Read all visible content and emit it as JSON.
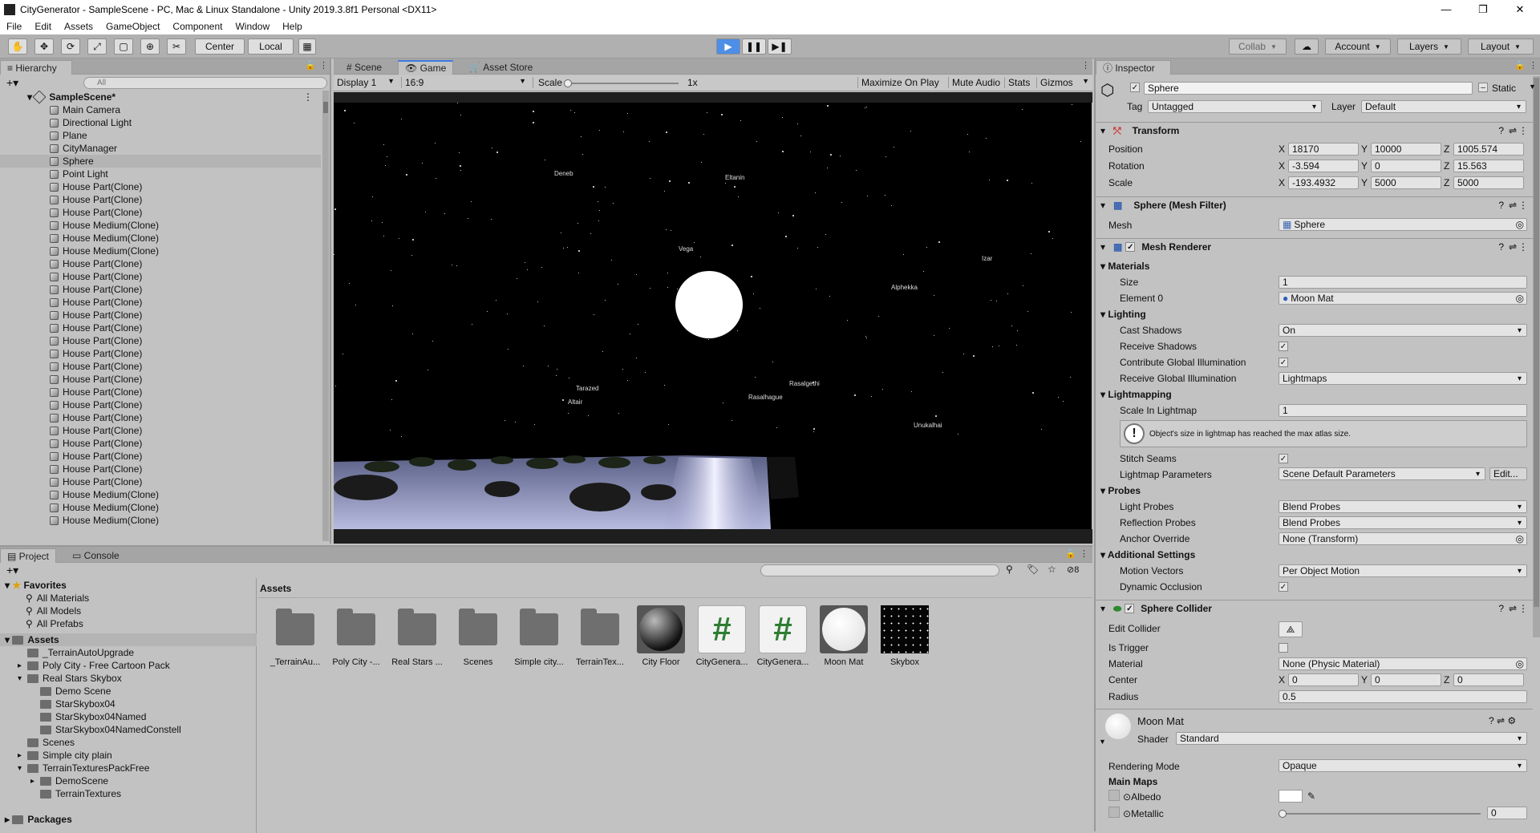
{
  "window": {
    "title": "CityGenerator - SampleScene - PC, Mac & Linux Standalone - Unity 2019.3.8f1 Personal <DX11>"
  },
  "menu": [
    "File",
    "Edit",
    "Assets",
    "GameObject",
    "Component",
    "Window",
    "Help"
  ],
  "toolbar": {
    "center_label": "Center",
    "local_label": "Local",
    "collab_label": "Collab",
    "account_label": "Account",
    "layers_label": "Layers",
    "layout_label": "Layout"
  },
  "hierarchy": {
    "tab": "Hierarchy",
    "search_placeholder": "All",
    "scene": "SampleScene*",
    "items": [
      "Main Camera",
      "Directional Light",
      "Plane",
      "CityManager",
      "Sphere",
      "Point Light",
      "House Part(Clone)",
      "House Part(Clone)",
      "House Part(Clone)",
      "House Medium(Clone)",
      "House Medium(Clone)",
      "House Medium(Clone)",
      "House Part(Clone)",
      "House Part(Clone)",
      "House Part(Clone)",
      "House Part(Clone)",
      "House Part(Clone)",
      "House Part(Clone)",
      "House Part(Clone)",
      "House Part(Clone)",
      "House Part(Clone)",
      "House Part(Clone)",
      "House Part(Clone)",
      "House Part(Clone)",
      "House Part(Clone)",
      "House Part(Clone)",
      "House Part(Clone)",
      "House Part(Clone)",
      "House Part(Clone)",
      "House Part(Clone)",
      "House Medium(Clone)",
      "House Medium(Clone)",
      "House Medium(Clone)"
    ],
    "selected": "Sphere"
  },
  "game": {
    "tabs": [
      "Scene",
      "Game",
      "Asset Store"
    ],
    "display": "Display 1",
    "aspect": "16:9",
    "scale_label": "Scale",
    "scale_value": "1x",
    "maximize": "Maximize On Play",
    "mute": "Mute Audio",
    "stats": "Stats",
    "gizmos": "Gizmos",
    "star_labels": [
      "Deneb",
      "Eltanin",
      "Vega",
      "Izar",
      "Alphekka",
      "Tarazed",
      "Altair",
      "Rasalgethi",
      "Rasalhague",
      "Unukalhai"
    ]
  },
  "project": {
    "tabs": [
      "Project",
      "Console"
    ],
    "favorites_label": "Favorites",
    "favorites": [
      "All Materials",
      "All Models",
      "All Prefabs"
    ],
    "assets_label": "Assets",
    "tree": [
      {
        "label": "_TerrainAutoUpgrade",
        "level": 1
      },
      {
        "label": "Poly City - Free Cartoon Pack",
        "level": 1
      },
      {
        "label": "Real Stars Skybox",
        "level": 1
      },
      {
        "label": "Demo Scene",
        "level": 2
      },
      {
        "label": "StarSkybox04",
        "level": 2
      },
      {
        "label": "StarSkybox04Named",
        "level": 2
      },
      {
        "label": "StarSkybox04NamedConstell",
        "level": 2
      },
      {
        "label": "Scenes",
        "level": 1
      },
      {
        "label": "Simple city plain",
        "level": 1
      },
      {
        "label": "TerrainTexturesPackFree",
        "level": 1
      },
      {
        "label": "DemoScene",
        "level": 2
      },
      {
        "label": "TerrainTextures",
        "level": 2
      }
    ],
    "packages_label": "Packages",
    "breadcrumb": "Assets",
    "hidden_count": "8",
    "assets": [
      {
        "name": "_TerrainAu...",
        "kind": "folder"
      },
      {
        "name": "Poly City -...",
        "kind": "folder"
      },
      {
        "name": "Real Stars ...",
        "kind": "folder"
      },
      {
        "name": "Scenes",
        "kind": "folder"
      },
      {
        "name": "Simple city...",
        "kind": "folder"
      },
      {
        "name": "TerrainTex...",
        "kind": "folder"
      },
      {
        "name": "City Floor",
        "kind": "sphere-dark"
      },
      {
        "name": "CityGenera...",
        "kind": "script"
      },
      {
        "name": "CityGenera...",
        "kind": "script"
      },
      {
        "name": "Moon Mat",
        "kind": "sphere-white"
      },
      {
        "name": "Skybox",
        "kind": "skybox"
      }
    ]
  },
  "inspector": {
    "tab": "Inspector",
    "object_name": "Sphere",
    "static_label": "Static",
    "tag_label": "Tag",
    "tag_value": "Untagged",
    "layer_label": "Layer",
    "layer_value": "Default",
    "transform": {
      "title": "Transform",
      "position_label": "Position",
      "rotation_label": "Rotation",
      "scale_label": "Scale",
      "position": [
        "18170",
        "10000",
        "1005.574"
      ],
      "rotation": [
        "-3.594",
        "0",
        "15.563"
      ],
      "scale": [
        "-193.4932",
        "5000",
        "5000"
      ]
    },
    "mesh_filter": {
      "title": "Sphere (Mesh Filter)",
      "mesh_label": "Mesh",
      "mesh_value": "Sphere"
    },
    "mesh_renderer": {
      "title": "Mesh Renderer",
      "materials": "Materials",
      "size_label": "Size",
      "size_value": "1",
      "element_label": "Element 0",
      "element_value": "Moon Mat",
      "lighting": "Lighting",
      "cast_label": "Cast Shadows",
      "cast_value": "On",
      "receive_label": "Receive Shadows",
      "contribute_label": "Contribute Global Illumination",
      "receive_gi_label": "Receive Global Illumination",
      "receive_gi_value": "Lightmaps",
      "lightmapping": "Lightmapping",
      "scale_lm_label": "Scale In Lightmap",
      "scale_lm_value": "1",
      "warning": "Object's size in lightmap has reached the max atlas size.",
      "stitch_label": "Stitch Seams",
      "lm_params_label": "Lightmap Parameters",
      "lm_params_value": "Scene Default Parameters",
      "edit_label": "Edit...",
      "probes": "Probes",
      "light_probes_label": "Light Probes",
      "light_probes_value": "Blend Probes",
      "refl_probes_label": "Reflection Probes",
      "refl_probes_value": "Blend Probes",
      "anchor_label": "Anchor Override",
      "anchor_value": "None (Transform)",
      "additional": "Additional Settings",
      "motion_label": "Motion Vectors",
      "motion_value": "Per Object Motion",
      "dynamic_label": "Dynamic Occlusion"
    },
    "sphere_collider": {
      "title": "Sphere Collider",
      "edit_label": "Edit Collider",
      "trigger_label": "Is Trigger",
      "material_label": "Material",
      "material_value": "None (Physic Material)",
      "center_label": "Center",
      "center": [
        "0",
        "0",
        "0"
      ],
      "radius_label": "Radius",
      "radius_value": "0.5"
    },
    "material": {
      "name": "Moon Mat",
      "shader_label": "Shader",
      "shader_value": "Standard",
      "rendering_label": "Rendering Mode",
      "rendering_value": "Opaque",
      "main_maps": "Main Maps",
      "albedo_label": "Albedo",
      "metallic_label": "Metallic",
      "metallic_value": "0"
    }
  }
}
